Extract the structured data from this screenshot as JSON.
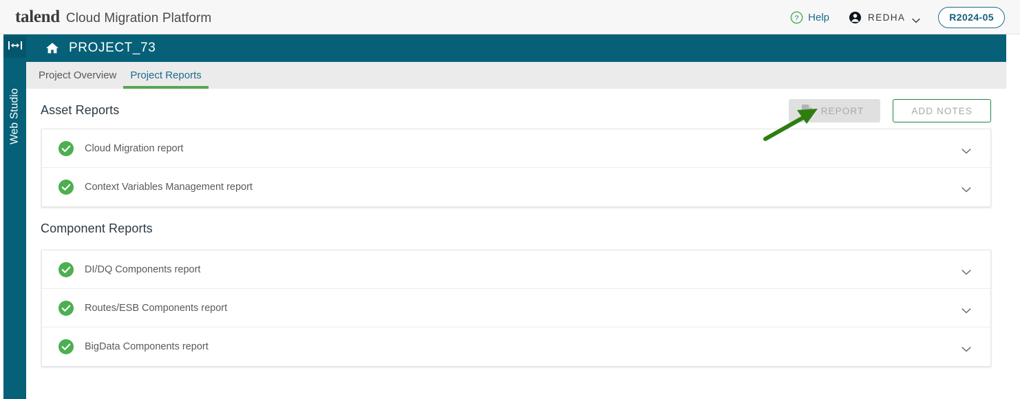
{
  "topbar": {
    "logo": "talend",
    "product": "Cloud Migration Platform",
    "help_label": "Help",
    "help_icon": "question-circle-icon",
    "user_name": "REDHA",
    "user_icon": "person-icon",
    "user_caret_icon": "chevron-down-icon",
    "release_badge": "R2024-05"
  },
  "rail": {
    "toggle_icon": "expand-horizontal-icon",
    "label": "Web Studio"
  },
  "project": {
    "home_icon": "home-icon",
    "name": "PROJECT_73"
  },
  "tabs": [
    {
      "label": "Project Overview",
      "active": false
    },
    {
      "label": "Project Reports",
      "active": true
    }
  ],
  "sections": [
    {
      "title": "Asset Reports",
      "actions": {
        "report_label": "REPORT",
        "report_icon": "document-chart-icon",
        "report_disabled": true,
        "add_notes_label": "ADD NOTES"
      },
      "rows": [
        {
          "status_icon": "check-circle-icon",
          "label": "Cloud Migration report",
          "caret_icon": "chevron-down-icon"
        },
        {
          "status_icon": "check-circle-icon",
          "label": "Context Variables Management report",
          "caret_icon": "chevron-down-icon"
        }
      ]
    },
    {
      "title": "Component Reports",
      "rows": [
        {
          "status_icon": "check-circle-icon",
          "label": "DI/DQ Components report",
          "caret_icon": "chevron-down-icon"
        },
        {
          "status_icon": "check-circle-icon",
          "label": "Routes/ESB Components report",
          "caret_icon": "chevron-down-icon"
        },
        {
          "status_icon": "check-circle-icon",
          "label": "BigData Components report",
          "caret_icon": "chevron-down-icon"
        }
      ]
    }
  ],
  "annotation": {
    "arrow_icon": "green-pointer-arrow",
    "color": "#2e7d11"
  },
  "colors": {
    "brand_teal": "#056078",
    "accent_green": "#56a551",
    "status_green": "#4caf50",
    "link_teal": "#1b6b8c",
    "tabbar_gray": "#ebebeb"
  }
}
